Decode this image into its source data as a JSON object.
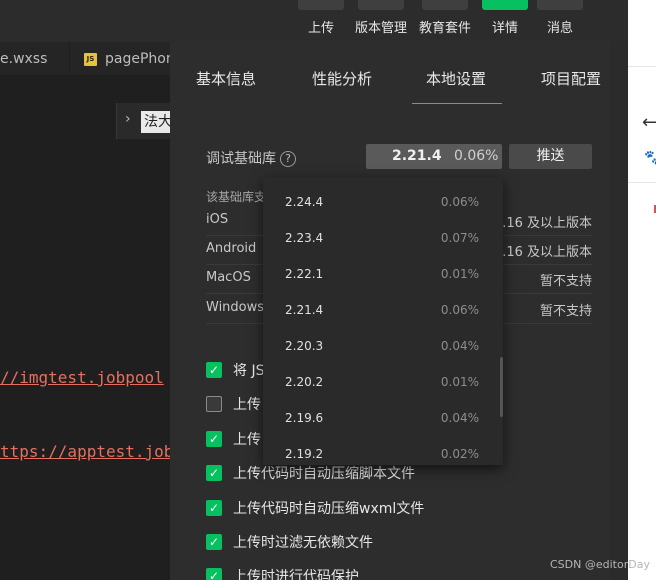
{
  "toolbar": {
    "buttons": [
      {
        "label": "上传",
        "icon": "upload-icon",
        "glyph": "⇧",
        "highlight": false
      },
      {
        "label": "版本管理",
        "icon": "branch-icon",
        "glyph": "⎇",
        "highlight": false
      },
      {
        "label": "教育套件",
        "icon": "education-icon",
        "glyph": "●",
        "highlight": false
      },
      {
        "label": "详情",
        "icon": "details-icon",
        "glyph": "≡",
        "highlight": true
      },
      {
        "label": "消息",
        "icon": "bell-icon",
        "glyph": "◔",
        "highlight": false
      }
    ]
  },
  "editor": {
    "tabs": [
      {
        "label": "e.wxss"
      },
      {
        "label": "pagePhon",
        "badge": "JS"
      }
    ],
    "breadcrumb": {
      "chevron": "›",
      "text": "法大"
    },
    "lines": [
      {
        "text": "//imgtest.jobpool"
      },
      {
        "text": "ttps://apptest.job"
      }
    ]
  },
  "panel": {
    "tabs": [
      "基本信息",
      "性能分析",
      "本地设置",
      "项目配置"
    ],
    "active_tab": "本地设置",
    "library": {
      "label": "调试基础库",
      "help": "?",
      "selected_version": "2.21.4",
      "selected_percent": "0.06%",
      "push_label": "推送"
    },
    "note": "该基础库支",
    "platforms": [
      {
        "name": "iOS",
        "value": "0.16 及以上版本"
      },
      {
        "name": "Android",
        "value": "0.16 及以上版本"
      },
      {
        "name": "MacOS",
        "value": "暂不支持"
      },
      {
        "name": "Windows",
        "value": "暂不支持"
      }
    ],
    "checks": [
      {
        "label": "将 JS",
        "checked": true
      },
      {
        "label": "上传",
        "checked": false
      },
      {
        "label": "上传",
        "checked": true
      },
      {
        "label": "上传代码时自动压缩脚本文件",
        "checked": true
      },
      {
        "label": "上传代码时自动压缩wxml文件",
        "checked": true
      },
      {
        "label": "上传时过滤无依赖文件",
        "checked": true
      },
      {
        "label": "上传时进行代码保护",
        "checked": true
      }
    ],
    "dropdown": [
      {
        "version": "2.24.4",
        "percent": "0.06%"
      },
      {
        "version": "2.23.4",
        "percent": "0.07%"
      },
      {
        "version": "2.22.1",
        "percent": "0.01%"
      },
      {
        "version": "2.21.4",
        "percent": "0.06%"
      },
      {
        "version": "2.20.3",
        "percent": "0.04%"
      },
      {
        "version": "2.20.2",
        "percent": "0.01%"
      },
      {
        "version": "2.19.6",
        "percent": "0.04%"
      },
      {
        "version": "2.19.2",
        "percent": "0.02%"
      }
    ]
  },
  "browser": {
    "back": "←",
    "logo": "🐾"
  },
  "watermark": "CSDN @editorDay",
  "colors": {
    "accent": "#07c160",
    "link": "#e5705f"
  }
}
